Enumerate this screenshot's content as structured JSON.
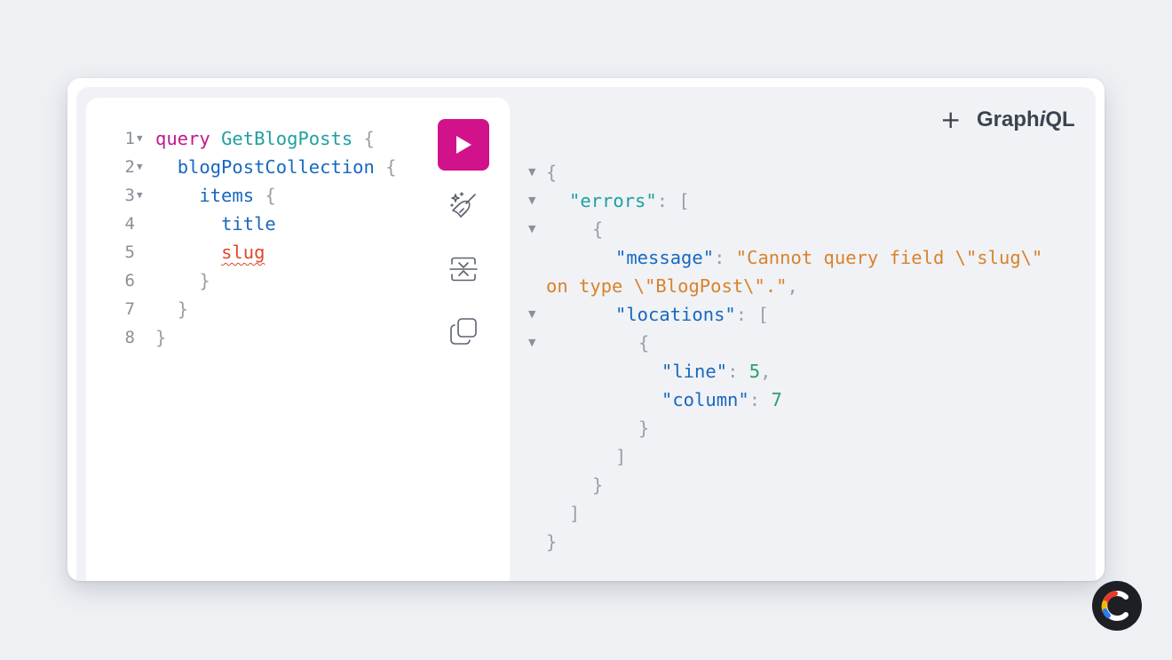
{
  "editor": {
    "lines": [
      {
        "num": "1",
        "fold": "▼",
        "indent": "",
        "parts": [
          {
            "t": "query",
            "c": "kw"
          },
          {
            "t": " ",
            "c": ""
          },
          {
            "t": "GetBlogPosts",
            "c": "op"
          },
          {
            "t": " {",
            "c": "brace"
          }
        ]
      },
      {
        "num": "2",
        "fold": "▼",
        "indent": "  ",
        "parts": [
          {
            "t": "blogPostCollection",
            "c": "fld"
          },
          {
            "t": " {",
            "c": "brace"
          }
        ]
      },
      {
        "num": "3",
        "fold": "▼",
        "indent": "    ",
        "parts": [
          {
            "t": "items",
            "c": "fld"
          },
          {
            "t": " {",
            "c": "brace"
          }
        ]
      },
      {
        "num": "4",
        "fold": "",
        "indent": "      ",
        "parts": [
          {
            "t": "title",
            "c": "fld"
          }
        ]
      },
      {
        "num": "5",
        "fold": "",
        "indent": "      ",
        "parts": [
          {
            "t": "slug",
            "c": "err"
          }
        ]
      },
      {
        "num": "6",
        "fold": "",
        "indent": "    ",
        "parts": [
          {
            "t": "}",
            "c": "brace"
          }
        ]
      },
      {
        "num": "7",
        "fold": "",
        "indent": "  ",
        "parts": [
          {
            "t": "}",
            "c": "brace"
          }
        ]
      },
      {
        "num": "8",
        "fold": "",
        "indent": "",
        "parts": [
          {
            "t": "}",
            "c": "brace"
          }
        ]
      }
    ]
  },
  "toolbar": {
    "run_icon": "play-icon",
    "prettify_icon": "magic-wand-icon",
    "merge_icon": "merge-fragments-icon",
    "copy_icon": "copy-icon"
  },
  "header": {
    "new_tab_label": "+",
    "logo_prefix": "Graph",
    "logo_italic": "i",
    "logo_suffix": "QL"
  },
  "response": {
    "lines": [
      {
        "fold": "▼",
        "indent": 0,
        "parts": [
          {
            "t": "{",
            "c": "rp"
          }
        ]
      },
      {
        "fold": "▼",
        "indent": 1,
        "parts": [
          {
            "t": "\"errors\"",
            "c": "rkey"
          },
          {
            "t": ": [",
            "c": "rp"
          }
        ]
      },
      {
        "fold": "▼",
        "indent": 2,
        "parts": [
          {
            "t": "{",
            "c": "rp"
          }
        ]
      },
      {
        "fold": "",
        "indent": 3,
        "parts": [
          {
            "t": "\"message\"",
            "c": "rkey2"
          },
          {
            "t": ": ",
            "c": "rp"
          },
          {
            "t": "\"Cannot query field \\\"slug\\\"",
            "c": "rstr"
          }
        ]
      },
      {
        "fold": "",
        "indent": 0,
        "parts": [
          {
            "t": "on type \\\"BlogPost\\\".\"",
            "c": "rstr"
          },
          {
            "t": ",",
            "c": "rp"
          }
        ]
      },
      {
        "fold": "▼",
        "indent": 3,
        "parts": [
          {
            "t": "\"locations\"",
            "c": "rkey2"
          },
          {
            "t": ": [",
            "c": "rp"
          }
        ]
      },
      {
        "fold": "▼",
        "indent": 4,
        "parts": [
          {
            "t": "{",
            "c": "rp"
          }
        ]
      },
      {
        "fold": "",
        "indent": 5,
        "parts": [
          {
            "t": "\"line\"",
            "c": "rkey2"
          },
          {
            "t": ": ",
            "c": "rp"
          },
          {
            "t": "5",
            "c": "rnum"
          },
          {
            "t": ",",
            "c": "rp"
          }
        ]
      },
      {
        "fold": "",
        "indent": 5,
        "parts": [
          {
            "t": "\"column\"",
            "c": "rkey2"
          },
          {
            "t": ": ",
            "c": "rp"
          },
          {
            "t": "7",
            "c": "rnum"
          }
        ]
      },
      {
        "fold": "",
        "indent": 4,
        "parts": [
          {
            "t": "}",
            "c": "rp"
          }
        ]
      },
      {
        "fold": "",
        "indent": 3,
        "parts": [
          {
            "t": "]",
            "c": "rp"
          }
        ]
      },
      {
        "fold": "",
        "indent": 2,
        "parts": [
          {
            "t": "}",
            "c": "rp"
          }
        ]
      },
      {
        "fold": "",
        "indent": 1,
        "parts": [
          {
            "t": "]",
            "c": "rp"
          }
        ]
      },
      {
        "fold": "",
        "indent": 0,
        "parts": [
          {
            "t": "}",
            "c": "rp"
          }
        ]
      }
    ]
  },
  "badge": {
    "icon": "coderpad-logo-icon"
  }
}
